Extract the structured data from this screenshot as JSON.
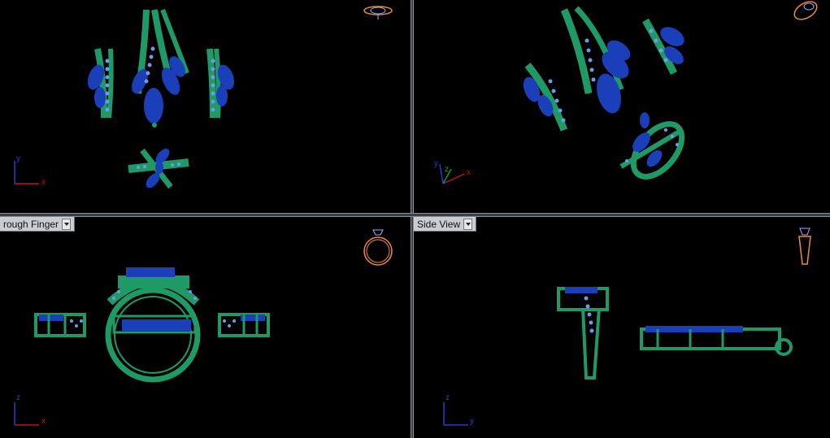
{
  "viewports": [
    {
      "id": "top-left",
      "title": "",
      "axes": [
        "y",
        "x"
      ]
    },
    {
      "id": "top-right",
      "title": "",
      "axes": [
        "y",
        "z",
        "x"
      ]
    },
    {
      "id": "bottom-left",
      "title": "rough Finger",
      "axes": [
        "z",
        "x"
      ]
    },
    {
      "id": "bottom-right",
      "title": "Side View",
      "axes": [
        "z",
        "y"
      ]
    }
  ],
  "colors": {
    "background": "#000000",
    "metal": "#1f9a67",
    "gem": "#1b3fb8",
    "small_stones": "#6f9be6",
    "axis_red": "#c0141a",
    "axis_green": "#1b9a2b",
    "axis_blue": "#2a3ad0",
    "gizmo": "#f08a32"
  }
}
